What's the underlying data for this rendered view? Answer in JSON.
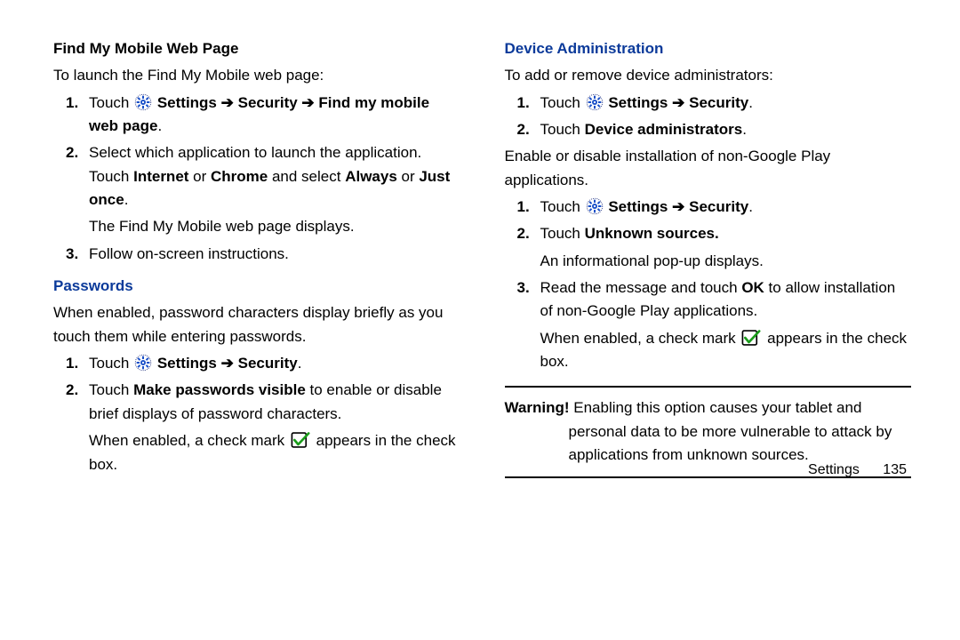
{
  "arrow": "➔",
  "left": {
    "fmm_heading": "Find My Mobile Web Page",
    "fmm_intro": "To launch the Find My Mobile web page:",
    "fmm_steps": {
      "s1a": "Touch ",
      "s1b": " Settings ",
      "s1c": " Security ",
      "s1d": " Find my mobile web page",
      "s1e": ".",
      "s2a": "Select which application to launch the application. Touch ",
      "s2b": "Internet",
      "s2c": " or ",
      "s2d": "Chrome",
      "s2e": " and select ",
      "s2f": "Always",
      "s2g": " or ",
      "s2h": "Just once",
      "s2i": ".",
      "s2j": "The Find My Mobile web page displays.",
      "s3": "Follow on-screen instructions."
    },
    "pw_heading": "Passwords",
    "pw_intro": "When enabled, password characters display briefly as you touch them while entering passwords.",
    "pw_steps": {
      "s1a": "Touch ",
      "s1b": " Settings ",
      "s1c": " Security",
      "s1d": ".",
      "s2a": "Touch ",
      "s2b": "Make passwords visible",
      "s2c": " to enable or disable brief displays of password characters.",
      "s2d": "When enabled, a check mark ",
      "s2e": " appears in the check box."
    }
  },
  "right": {
    "da_heading": "Device Administration",
    "da_intro": "To add or remove device administrators:",
    "da_steps": {
      "s1a": "Touch ",
      "s1b": " Settings ",
      "s1c": " Security",
      "s1d": ".",
      "s2a": "Touch ",
      "s2b": "Device administrators",
      "s2c": "."
    },
    "us_intro": "Enable or disable installation of non-Google Play applications.",
    "us_steps": {
      "s1a": "Touch ",
      "s1b": " Settings ",
      "s1c": " Security",
      "s1d": ".",
      "s2a": "Touch ",
      "s2b": "Unknown sources.",
      "s2c": "An informational pop-up displays.",
      "s3a": "Read the message and touch ",
      "s3b": "OK",
      "s3c": " to allow installation of non-Google Play applications.",
      "s3d": "When enabled, a check mark ",
      "s3e": " appears in the check box."
    },
    "warning_label": "Warning!",
    "warning_text": " Enabling this option causes your tablet and personal data to be more vulnerable to attack by applications from unknown sources."
  },
  "footer": {
    "section": "Settings",
    "page": "135"
  }
}
